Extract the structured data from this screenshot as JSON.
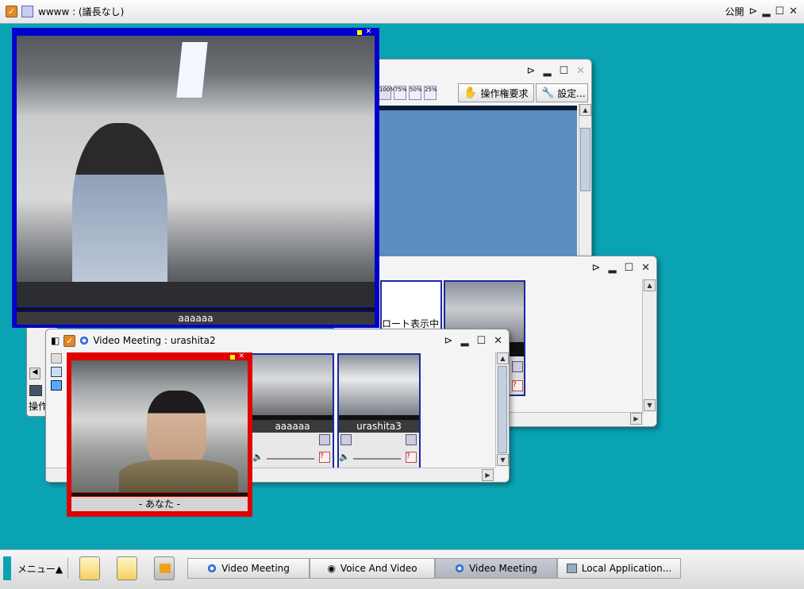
{
  "top_bar": {
    "title": "wwww : (議長なし)",
    "public_label": "公開"
  },
  "wb_window": {
    "zoom_buttons": [
      "100%",
      "75%",
      "50%",
      "25%"
    ],
    "control_request": "操作権要求",
    "settings": "設定..."
  },
  "remote_window": {
    "status_text": "ロート表示中"
  },
  "left_strip": {
    "label": "操作"
  },
  "video_meeting": {
    "title": "Video Meeting : urashita2",
    "tiles": [
      {
        "name": "aaaaaa"
      },
      {
        "name": "urashita3"
      }
    ]
  },
  "big_video": {
    "name": "aaaaaa"
  },
  "self_video": {
    "name": "- あなた -"
  },
  "taskbar": {
    "menu": "メニュー▲",
    "tasks": [
      {
        "label": "Video Meeting",
        "icon": "gear-icon"
      },
      {
        "label": "Voice And Video",
        "icon": "webcam-icon"
      },
      {
        "label": "Video Meeting",
        "icon": "gear-icon"
      },
      {
        "label": "Local Application...",
        "icon": "app-icon"
      }
    ]
  },
  "colors": {
    "desktop": "#0aa3b3",
    "big_video_border": "#0000cc",
    "self_video_border": "#e00000",
    "accent": "#e08a2a"
  }
}
